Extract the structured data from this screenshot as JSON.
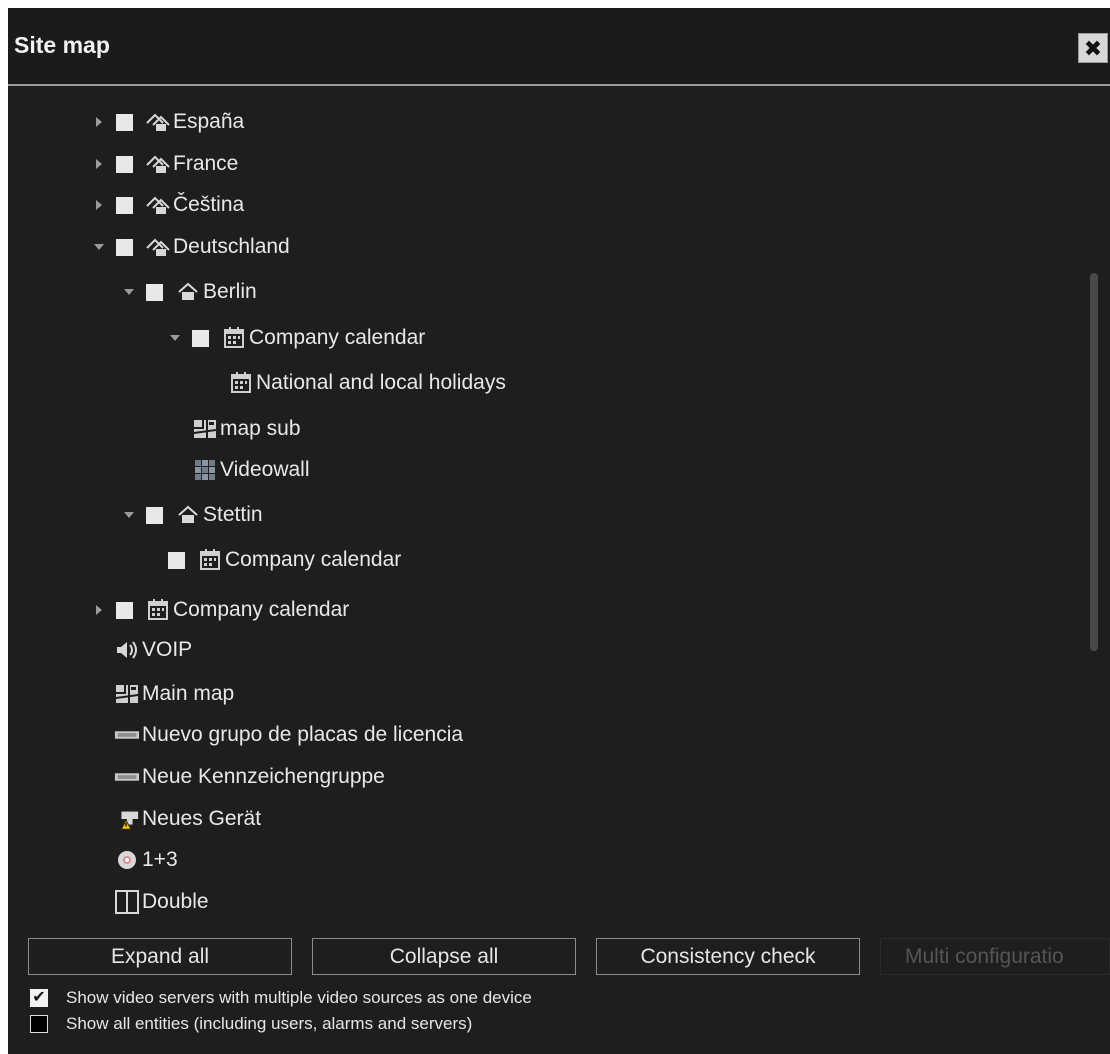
{
  "window": {
    "title": "Site map",
    "close_label": "✖"
  },
  "tree": [
    {
      "label": "España",
      "arrow": "right",
      "checkbox": true,
      "icon": "house-group-icon"
    },
    {
      "label": "France",
      "arrow": "right",
      "checkbox": true,
      "icon": "house-group-icon"
    },
    {
      "label": "Čeština",
      "arrow": "right",
      "checkbox": true,
      "icon": "house-group-icon"
    },
    {
      "label": "Deutschland",
      "arrow": "down",
      "checkbox": true,
      "icon": "house-group-icon"
    },
    {
      "label": "Berlin",
      "arrow": "down",
      "checkbox": true,
      "icon": "house-icon"
    },
    {
      "label": "Company calendar",
      "arrow": "down",
      "checkbox": true,
      "icon": "calendar-icon"
    },
    {
      "label": "National and local holidays",
      "arrow": "none",
      "checkbox": false,
      "icon": "calendar-icon"
    },
    {
      "label": "map sub",
      "arrow": "none",
      "checkbox": false,
      "icon": "map-icon"
    },
    {
      "label": "Videowall",
      "arrow": "none",
      "checkbox": false,
      "icon": "videowall-icon"
    },
    {
      "label": "Stettin",
      "arrow": "down",
      "checkbox": true,
      "icon": "house-icon"
    },
    {
      "label": "Company calendar",
      "arrow": "none",
      "checkbox": true,
      "icon": "calendar-icon"
    },
    {
      "label": "Company calendar",
      "arrow": "right",
      "checkbox": true,
      "icon": "calendar-icon"
    },
    {
      "label": "VOIP",
      "arrow": "none",
      "checkbox": false,
      "icon": "speaker-icon"
    },
    {
      "label": "Main map",
      "arrow": "none",
      "checkbox": false,
      "icon": "map-icon"
    },
    {
      "label": "Nuevo grupo de placas de licencia",
      "arrow": "none",
      "checkbox": false,
      "icon": "license-plate-icon"
    },
    {
      "label": "Neue Kennzeichengruppe",
      "arrow": "none",
      "checkbox": false,
      "icon": "license-plate-icon"
    },
    {
      "label": "Neues Gerät",
      "arrow": "none",
      "checkbox": false,
      "icon": "device-warning-icon"
    },
    {
      "label": "1+3",
      "arrow": "none",
      "checkbox": false,
      "icon": "camera-ball-icon"
    },
    {
      "label": "Double",
      "arrow": "none",
      "checkbox": false,
      "icon": "split-layout-icon"
    }
  ],
  "buttons": {
    "expand_all": "Expand all",
    "collapse_all": "Collapse all",
    "consistency_check": "Consistency check",
    "multi_configuration": "Multi configuratio"
  },
  "options": {
    "one_device": {
      "label": "Show video servers with multiple video sources as one device",
      "checked": true,
      "mark": "✔"
    },
    "all_entities": {
      "label": "Show all entities (including users, alarms and servers)",
      "checked": false
    }
  },
  "colors": {
    "background": "#1e1e1e",
    "text": "#e6e6e6",
    "checkbox": "#e8e8e8",
    "warning": "#f5c400"
  }
}
